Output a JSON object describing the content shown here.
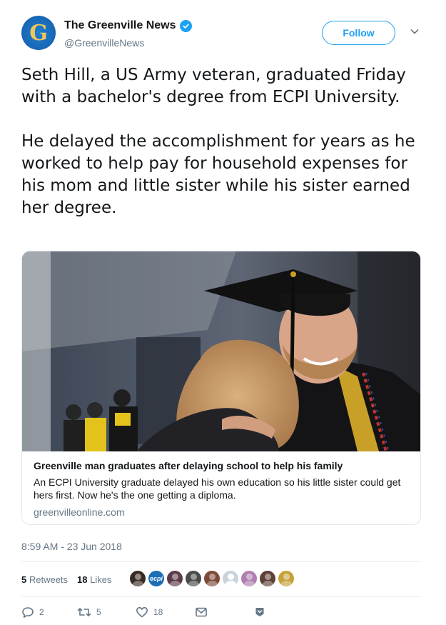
{
  "account": {
    "display_name": "The Greenville News",
    "handle": "@GreenvilleNews",
    "avatar_letter": "G",
    "verified": true
  },
  "follow_label": "Follow",
  "tweet": {
    "paragraph1": "Seth Hill, a US Army veteran, graduated Friday with a bachelor's degree from ECPI University.",
    "paragraph2": "He delayed the accomplishment for years as he worked to help pay for household expenses for his mom and little sister while his sister earned her degree."
  },
  "card": {
    "title": "Greenville man graduates after delaying school to help his family",
    "description": "An ECPI University graduate delayed his own education so his little sister could get hers first. Now he's the one getting a diploma.",
    "domain": "greenvilleonline.com"
  },
  "timestamp": "8:59 AM - 23 Jun 2018",
  "stats": {
    "retweets_count": "5",
    "retweets_label": " Retweets",
    "likes_count": "18",
    "likes_label": " Likes"
  },
  "likers": [
    {
      "kind": "photo",
      "color": "#3a2a24"
    },
    {
      "kind": "logo",
      "text": "ecpi",
      "color": "#1c6fb5"
    },
    {
      "kind": "photo",
      "color": "#5c3b4a"
    },
    {
      "kind": "photo",
      "color": "#4a4a4a"
    },
    {
      "kind": "photo",
      "color": "#7d4a3a"
    },
    {
      "kind": "default",
      "color": "#c9d3db"
    },
    {
      "kind": "photo",
      "color": "#b07fb0"
    },
    {
      "kind": "photo",
      "color": "#5d4037"
    },
    {
      "kind": "photo",
      "color": "#c7a23a"
    }
  ],
  "actions": {
    "reply_count": "2",
    "retweet_count": "5",
    "like_count": "18"
  },
  "colors": {
    "accent": "#1da1f2",
    "text_primary": "#14171a",
    "text_secondary": "#657786",
    "border": "#e6ecf0"
  },
  "icons": [
    "verified-badge-icon",
    "chevron-down-icon",
    "reply-icon",
    "retweet-icon",
    "heart-icon",
    "envelope-icon",
    "bookmark-icon"
  ]
}
